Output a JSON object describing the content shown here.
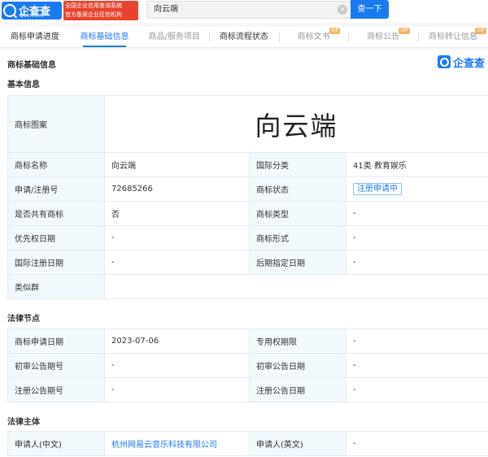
{
  "header": {
    "brand": "企查查",
    "domain": "Qcc.com",
    "slogan_line1": "全国企业信用查询系统",
    "slogan_line2": "官方备案企业征信机构",
    "search_value": "向云端",
    "search_button": "查一下"
  },
  "tabs": [
    {
      "label": "商标申请进度"
    },
    {
      "label": "商标基础信息"
    },
    {
      "label": "商品/服务项目"
    },
    {
      "label": "商标流程状态"
    },
    {
      "label": "商标文书",
      "badge": "VIP"
    },
    {
      "label": "商标公告",
      "badge": "VIP"
    },
    {
      "label": "商标转让信息",
      "badge": "VIP"
    }
  ],
  "page_title": "商标基础信息",
  "corner_brand": "企查查",
  "basic": {
    "title": "基本信息",
    "image_label": "商标图案",
    "mark_text": "向云端",
    "rows": [
      {
        "l1": "商标名称",
        "v1": "向云端",
        "l2": "国际分类",
        "v2": "41类 教育娱乐"
      },
      {
        "l1": "申请/注册号",
        "v1": "72685266",
        "l2": "商标状态",
        "v2": "注册申请中"
      },
      {
        "l1": "是否共有商标",
        "v1": "否",
        "l2": "商标类型",
        "v2": "-"
      },
      {
        "l1": "优先权日期",
        "v1": "-",
        "l2": "商标形式",
        "v2": "-"
      },
      {
        "l1": "国际注册日期",
        "v1": "-",
        "l2": "后期指定日期",
        "v2": "-"
      }
    ],
    "similar_label": "类似群",
    "similar_value": ""
  },
  "legal_nodes": {
    "title": "法律节点",
    "rows": [
      {
        "l1": "商标申请日期",
        "v1": "2023-07-06",
        "l2": "专用权期限",
        "v2": "-"
      },
      {
        "l1": "初审公告期号",
        "v1": "-",
        "l2": "初审公告日期",
        "v2": "-"
      },
      {
        "l1": "注册公告期号",
        "v1": "-",
        "l2": "注册公告日期",
        "v2": "-"
      }
    ]
  },
  "legal_subject": {
    "title": "法律主体",
    "rows": [
      {
        "l1": "申请人(中文)",
        "v1": "杭州网易云音乐科技有限公司",
        "l2": "申请人(英文)",
        "v2": "-"
      }
    ]
  }
}
